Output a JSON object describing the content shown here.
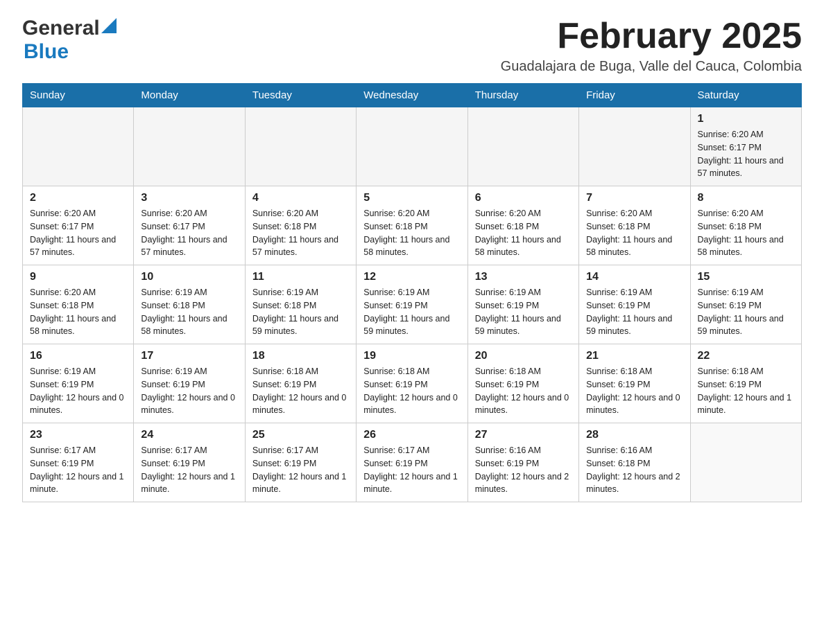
{
  "header": {
    "logo_general": "General",
    "logo_blue": "Blue",
    "month_title": "February 2025",
    "location": "Guadalajara de Buga, Valle del Cauca, Colombia"
  },
  "days_of_week": [
    "Sunday",
    "Monday",
    "Tuesday",
    "Wednesday",
    "Thursday",
    "Friday",
    "Saturday"
  ],
  "weeks": [
    [
      {
        "day": "",
        "sunrise": "",
        "sunset": "",
        "daylight": ""
      },
      {
        "day": "",
        "sunrise": "",
        "sunset": "",
        "daylight": ""
      },
      {
        "day": "",
        "sunrise": "",
        "sunset": "",
        "daylight": ""
      },
      {
        "day": "",
        "sunrise": "",
        "sunset": "",
        "daylight": ""
      },
      {
        "day": "",
        "sunrise": "",
        "sunset": "",
        "daylight": ""
      },
      {
        "day": "",
        "sunrise": "",
        "sunset": "",
        "daylight": ""
      },
      {
        "day": "1",
        "sunrise": "Sunrise: 6:20 AM",
        "sunset": "Sunset: 6:17 PM",
        "daylight": "Daylight: 11 hours and 57 minutes."
      }
    ],
    [
      {
        "day": "2",
        "sunrise": "Sunrise: 6:20 AM",
        "sunset": "Sunset: 6:17 PM",
        "daylight": "Daylight: 11 hours and 57 minutes."
      },
      {
        "day": "3",
        "sunrise": "Sunrise: 6:20 AM",
        "sunset": "Sunset: 6:17 PM",
        "daylight": "Daylight: 11 hours and 57 minutes."
      },
      {
        "day": "4",
        "sunrise": "Sunrise: 6:20 AM",
        "sunset": "Sunset: 6:18 PM",
        "daylight": "Daylight: 11 hours and 57 minutes."
      },
      {
        "day": "5",
        "sunrise": "Sunrise: 6:20 AM",
        "sunset": "Sunset: 6:18 PM",
        "daylight": "Daylight: 11 hours and 58 minutes."
      },
      {
        "day": "6",
        "sunrise": "Sunrise: 6:20 AM",
        "sunset": "Sunset: 6:18 PM",
        "daylight": "Daylight: 11 hours and 58 minutes."
      },
      {
        "day": "7",
        "sunrise": "Sunrise: 6:20 AM",
        "sunset": "Sunset: 6:18 PM",
        "daylight": "Daylight: 11 hours and 58 minutes."
      },
      {
        "day": "8",
        "sunrise": "Sunrise: 6:20 AM",
        "sunset": "Sunset: 6:18 PM",
        "daylight": "Daylight: 11 hours and 58 minutes."
      }
    ],
    [
      {
        "day": "9",
        "sunrise": "Sunrise: 6:20 AM",
        "sunset": "Sunset: 6:18 PM",
        "daylight": "Daylight: 11 hours and 58 minutes."
      },
      {
        "day": "10",
        "sunrise": "Sunrise: 6:19 AM",
        "sunset": "Sunset: 6:18 PM",
        "daylight": "Daylight: 11 hours and 58 minutes."
      },
      {
        "day": "11",
        "sunrise": "Sunrise: 6:19 AM",
        "sunset": "Sunset: 6:18 PM",
        "daylight": "Daylight: 11 hours and 59 minutes."
      },
      {
        "day": "12",
        "sunrise": "Sunrise: 6:19 AM",
        "sunset": "Sunset: 6:19 PM",
        "daylight": "Daylight: 11 hours and 59 minutes."
      },
      {
        "day": "13",
        "sunrise": "Sunrise: 6:19 AM",
        "sunset": "Sunset: 6:19 PM",
        "daylight": "Daylight: 11 hours and 59 minutes."
      },
      {
        "day": "14",
        "sunrise": "Sunrise: 6:19 AM",
        "sunset": "Sunset: 6:19 PM",
        "daylight": "Daylight: 11 hours and 59 minutes."
      },
      {
        "day": "15",
        "sunrise": "Sunrise: 6:19 AM",
        "sunset": "Sunset: 6:19 PM",
        "daylight": "Daylight: 11 hours and 59 minutes."
      }
    ],
    [
      {
        "day": "16",
        "sunrise": "Sunrise: 6:19 AM",
        "sunset": "Sunset: 6:19 PM",
        "daylight": "Daylight: 12 hours and 0 minutes."
      },
      {
        "day": "17",
        "sunrise": "Sunrise: 6:19 AM",
        "sunset": "Sunset: 6:19 PM",
        "daylight": "Daylight: 12 hours and 0 minutes."
      },
      {
        "day": "18",
        "sunrise": "Sunrise: 6:18 AM",
        "sunset": "Sunset: 6:19 PM",
        "daylight": "Daylight: 12 hours and 0 minutes."
      },
      {
        "day": "19",
        "sunrise": "Sunrise: 6:18 AM",
        "sunset": "Sunset: 6:19 PM",
        "daylight": "Daylight: 12 hours and 0 minutes."
      },
      {
        "day": "20",
        "sunrise": "Sunrise: 6:18 AM",
        "sunset": "Sunset: 6:19 PM",
        "daylight": "Daylight: 12 hours and 0 minutes."
      },
      {
        "day": "21",
        "sunrise": "Sunrise: 6:18 AM",
        "sunset": "Sunset: 6:19 PM",
        "daylight": "Daylight: 12 hours and 0 minutes."
      },
      {
        "day": "22",
        "sunrise": "Sunrise: 6:18 AM",
        "sunset": "Sunset: 6:19 PM",
        "daylight": "Daylight: 12 hours and 1 minute."
      }
    ],
    [
      {
        "day": "23",
        "sunrise": "Sunrise: 6:17 AM",
        "sunset": "Sunset: 6:19 PM",
        "daylight": "Daylight: 12 hours and 1 minute."
      },
      {
        "day": "24",
        "sunrise": "Sunrise: 6:17 AM",
        "sunset": "Sunset: 6:19 PM",
        "daylight": "Daylight: 12 hours and 1 minute."
      },
      {
        "day": "25",
        "sunrise": "Sunrise: 6:17 AM",
        "sunset": "Sunset: 6:19 PM",
        "daylight": "Daylight: 12 hours and 1 minute."
      },
      {
        "day": "26",
        "sunrise": "Sunrise: 6:17 AM",
        "sunset": "Sunset: 6:19 PM",
        "daylight": "Daylight: 12 hours and 1 minute."
      },
      {
        "day": "27",
        "sunrise": "Sunrise: 6:16 AM",
        "sunset": "Sunset: 6:19 PM",
        "daylight": "Daylight: 12 hours and 2 minutes."
      },
      {
        "day": "28",
        "sunrise": "Sunrise: 6:16 AM",
        "sunset": "Sunset: 6:18 PM",
        "daylight": "Daylight: 12 hours and 2 minutes."
      },
      {
        "day": "",
        "sunrise": "",
        "sunset": "",
        "daylight": ""
      }
    ]
  ]
}
